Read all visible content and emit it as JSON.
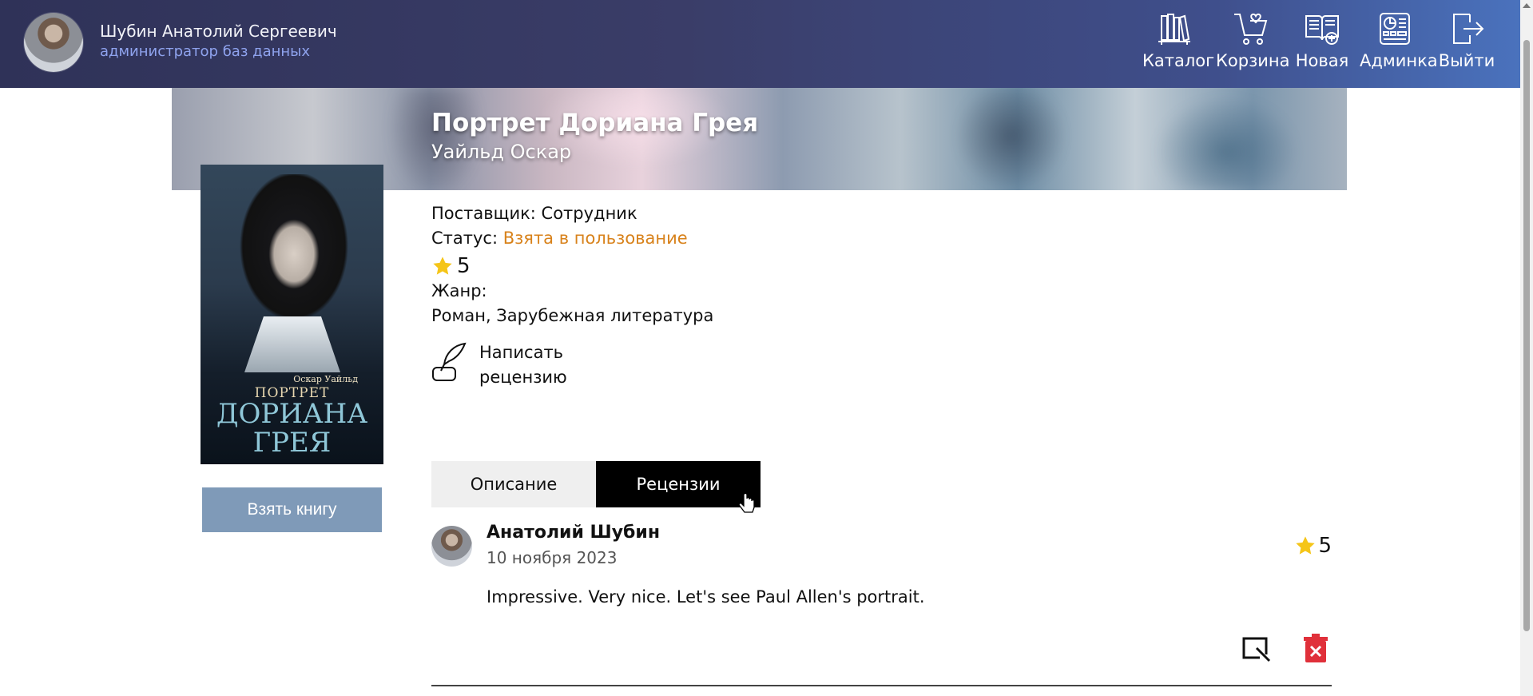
{
  "header": {
    "user_name": "Шубин Анатолий Сергеевич",
    "user_role": "администратор баз данных",
    "nav": [
      {
        "label": "Каталог",
        "icon": "books-icon"
      },
      {
        "label": "Корзина",
        "icon": "cart-icon"
      },
      {
        "label": "Новая",
        "icon": "new-book-icon"
      },
      {
        "label": "Админка",
        "icon": "admin-panel-icon"
      },
      {
        "label": "Выйти",
        "icon": "logout-icon"
      }
    ]
  },
  "book": {
    "title": "Портрет Дориана Грея",
    "author": "Уайльд Оскар",
    "cover": {
      "author_text": "Оскар Уайльд",
      "title_line1": "ПОРТРЕТ",
      "title_line2": "ДОРИАНА",
      "title_line3": "ГРЕЯ"
    },
    "supplier_label": "Поставщик:",
    "supplier_value": "Сотрудник",
    "status_label": "Статус:",
    "status_value": "Взята в пользование",
    "rating": "5",
    "genre_label": "Жанр:",
    "genre_value": "Роман, Зарубежная литература",
    "write_review_line1": "Написать",
    "write_review_line2": "рецензию",
    "take_button": "Взять книгу"
  },
  "tabs": [
    {
      "label": "Описание",
      "active": false
    },
    {
      "label": "Рецензии",
      "active": true
    }
  ],
  "reviews": [
    {
      "author": "Анатолий Шубин",
      "date": "10 ноября 2023",
      "rating": "5",
      "text": "Impressive. Very nice. Let's see Paul Allen's portrait."
    }
  ],
  "colors": {
    "status": "#d8821b",
    "take_button": "#7f9ab8",
    "star": "#f5c518",
    "delete": "#e0303a"
  }
}
